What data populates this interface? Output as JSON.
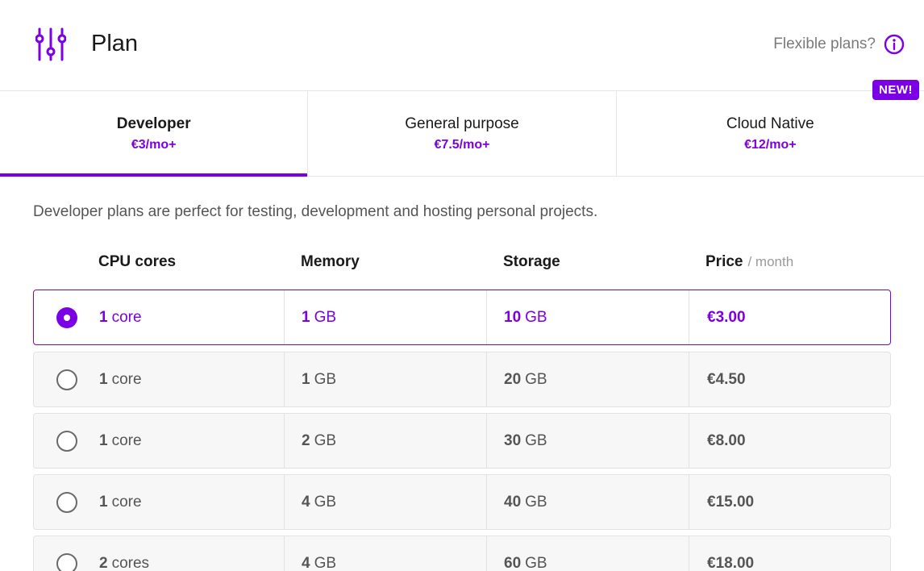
{
  "header": {
    "title": "Plan",
    "icon": "sliders-icon",
    "flexible_label": "Flexible plans?",
    "flexible_icon": "info-icon"
  },
  "colors": {
    "accent": "#7b00e6",
    "text": "#1a1a1a",
    "muted": "#7a7a7a"
  },
  "tabs": [
    {
      "name": "Developer",
      "price": "€3/mo+",
      "active": true
    },
    {
      "name": "General purpose",
      "price": "€7.5/mo+",
      "active": false
    },
    {
      "name": "Cloud Native",
      "price": "€12/mo+",
      "active": false,
      "badge": "NEW!"
    }
  ],
  "description": "Developer plans are perfect for testing, development and hosting personal projects.",
  "columns": {
    "cpu": "CPU cores",
    "memory": "Memory",
    "storage": "Storage",
    "price": "Price",
    "price_suffix": "/ month"
  },
  "plans": [
    {
      "cpu_num": "1",
      "cpu_unit": "core",
      "mem_num": "1",
      "mem_unit": "GB",
      "storage_num": "10",
      "storage_unit": "GB",
      "price": "€3.00",
      "selected": true
    },
    {
      "cpu_num": "1",
      "cpu_unit": "core",
      "mem_num": "1",
      "mem_unit": "GB",
      "storage_num": "20",
      "storage_unit": "GB",
      "price": "€4.50",
      "selected": false
    },
    {
      "cpu_num": "1",
      "cpu_unit": "core",
      "mem_num": "2",
      "mem_unit": "GB",
      "storage_num": "30",
      "storage_unit": "GB",
      "price": "€8.00",
      "selected": false
    },
    {
      "cpu_num": "1",
      "cpu_unit": "core",
      "mem_num": "4",
      "mem_unit": "GB",
      "storage_num": "40",
      "storage_unit": "GB",
      "price": "€15.00",
      "selected": false
    },
    {
      "cpu_num": "2",
      "cpu_unit": "cores",
      "mem_num": "4",
      "mem_unit": "GB",
      "storage_num": "60",
      "storage_unit": "GB",
      "price": "€18.00",
      "selected": false
    }
  ]
}
